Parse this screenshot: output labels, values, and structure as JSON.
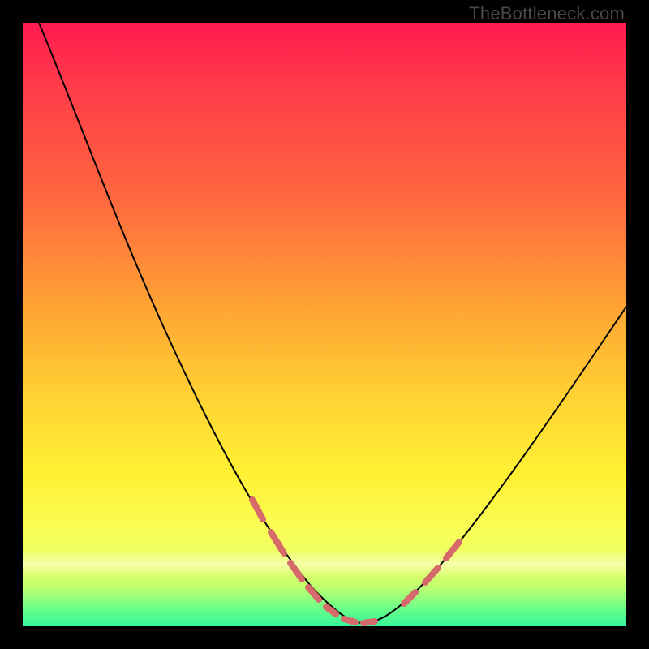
{
  "watermark": "TheBottleneck.com",
  "colors": {
    "frame": "#000000",
    "curve": "#000000",
    "dash_overlay": "#d66a6a",
    "gradient_top": "#ff1a4f",
    "gradient_mid": "#ffd533",
    "gradient_bottom": "#35f59a"
  },
  "chart_data": {
    "type": "line",
    "title": "",
    "xlabel": "",
    "ylabel": "",
    "xlim": [
      0,
      100
    ],
    "ylim": [
      0,
      100
    ],
    "grid": false,
    "note": "Bottleneck-style V curve. x roughly represents component balance position; y is bottleneck percentage. Minimum (~0%) near x≈55. Values estimated from pixel positions on an unlabeled plot.",
    "series": [
      {
        "name": "bottleneck-curve",
        "x": [
          0,
          5,
          10,
          15,
          20,
          25,
          30,
          35,
          40,
          45,
          50,
          55,
          60,
          65,
          70,
          75,
          80,
          85,
          90,
          95,
          100
        ],
        "y": [
          100,
          95,
          88,
          79,
          70,
          60,
          49,
          38,
          27,
          16,
          6,
          1,
          1,
          5,
          12,
          19,
          27,
          35,
          43,
          52,
          60
        ]
      }
    ],
    "annotations": [
      {
        "name": "highlighted-left-descent",
        "style": "salmon-dashed",
        "x_range": [
          37,
          54
        ],
        "y_range": [
          23,
          1
        ]
      },
      {
        "name": "highlighted-right-ascent",
        "style": "salmon-dashed",
        "x_range": [
          62,
          72
        ],
        "y_range": [
          3,
          16
        ]
      }
    ]
  }
}
